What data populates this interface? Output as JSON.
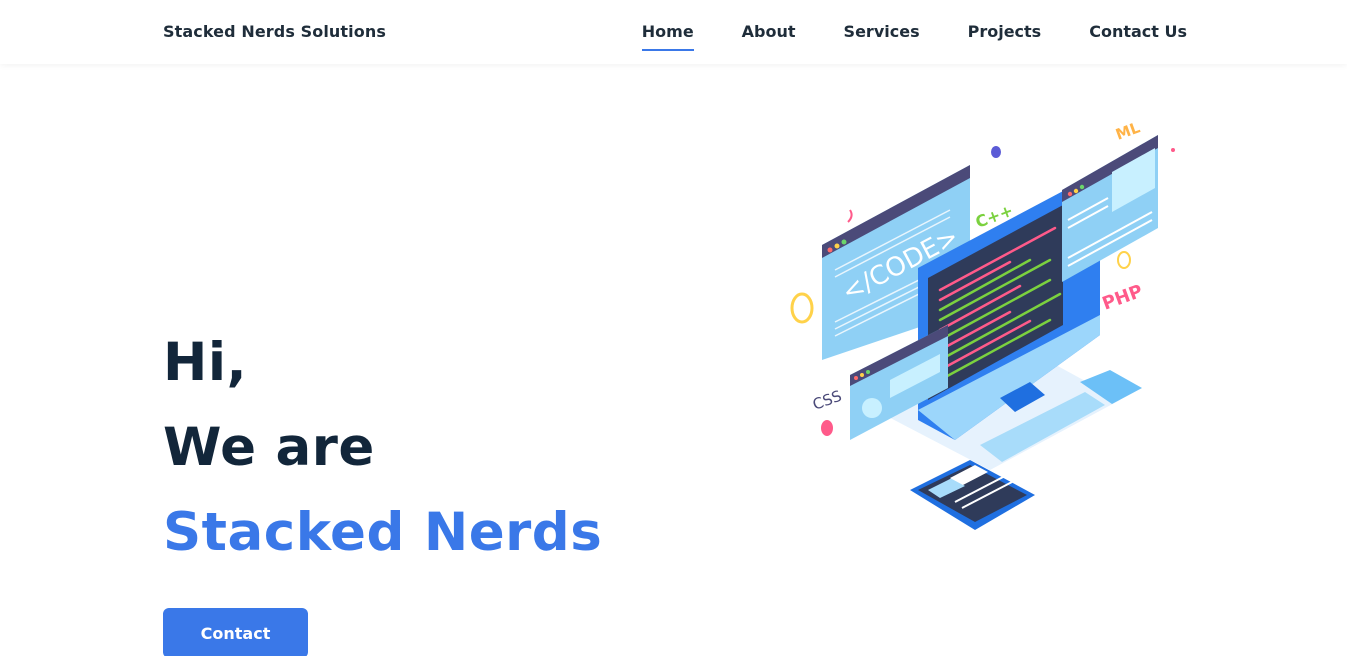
{
  "navbar": {
    "brand": "Stacked Nerds Solutions",
    "links": [
      {
        "label": "Home",
        "active": true
      },
      {
        "label": "About"
      },
      {
        "label": "Services"
      },
      {
        "label": "Projects"
      },
      {
        "label": "Contact Us"
      }
    ]
  },
  "hero": {
    "line1": "Hi,",
    "line2": "We are",
    "line3": "Stacked Nerds",
    "button": "Contact"
  },
  "illustration": {
    "code_label": "</CODE>",
    "tags": {
      "cpp": "C++",
      "php": "PHP",
      "css": "CSS",
      "xml": "ML"
    }
  },
  "colors": {
    "accent": "#3a78e8",
    "heading": "#12263a"
  }
}
